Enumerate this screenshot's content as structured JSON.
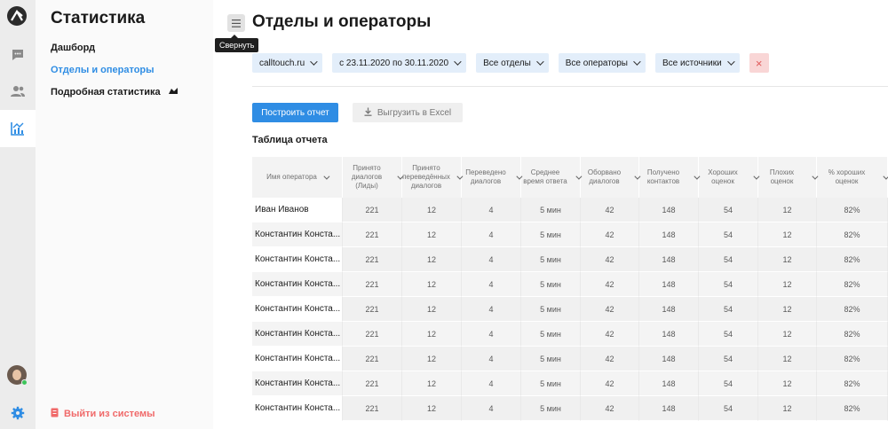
{
  "sidebar": {
    "title": "Статистика",
    "items": [
      {
        "label": "Дашборд"
      },
      {
        "label": "Отделы и операторы"
      },
      {
        "label": "Подробная статистика"
      }
    ],
    "logout_label": "Выйти из системы"
  },
  "header": {
    "title": "Отделы и операторы",
    "collapse_tooltip": "Свернуть"
  },
  "filters": [
    {
      "label": "calltouch.ru"
    },
    {
      "label": "с 23.11.2020 по 30.11.2020"
    },
    {
      "label": "Все отделы"
    },
    {
      "label": "Все операторы"
    },
    {
      "label": "Все источники"
    }
  ],
  "clear_label": "×",
  "actions": {
    "build_label": "Построить отчет",
    "export_label": "Выгрузить в Excel"
  },
  "table": {
    "title": "Таблица отчета",
    "columns": [
      "Имя оператора",
      "Принято диалогов (Лиды)",
      "Принято переведённых диалогов",
      "Переведено диалогов",
      "Среднее время ответа",
      "Оборвано диалогов",
      "Получено контактов",
      "Хороших оценок",
      "Плохих оценок",
      "% хороших оценок"
    ],
    "rows": [
      [
        "Иван Иванов",
        "221",
        "12",
        "4",
        "5 мин",
        "42",
        "148",
        "54",
        "12",
        "82%"
      ],
      [
        "Константин Конста...",
        "221",
        "12",
        "4",
        "5 мин",
        "42",
        "148",
        "54",
        "12",
        "82%"
      ],
      [
        "Константин Конста...",
        "221",
        "12",
        "4",
        "5 мин",
        "42",
        "148",
        "54",
        "12",
        "82%"
      ],
      [
        "Константин Конста...",
        "221",
        "12",
        "4",
        "5 мин",
        "42",
        "148",
        "54",
        "12",
        "82%"
      ],
      [
        "Константин Конста...",
        "221",
        "12",
        "4",
        "5 мин",
        "42",
        "148",
        "54",
        "12",
        "82%"
      ],
      [
        "Константин Конста...",
        "221",
        "12",
        "4",
        "5 мин",
        "42",
        "148",
        "54",
        "12",
        "82%"
      ],
      [
        "Константин Конста...",
        "221",
        "12",
        "4",
        "5 мин",
        "42",
        "148",
        "54",
        "12",
        "82%"
      ],
      [
        "Константин Конста...",
        "221",
        "12",
        "4",
        "5 мин",
        "42",
        "148",
        "54",
        "12",
        "82%"
      ],
      [
        "Константин Конста...",
        "221",
        "12",
        "4",
        "5 мин",
        "42",
        "148",
        "54",
        "12",
        "82%"
      ]
    ]
  },
  "colors": {
    "accent": "#2f8de4",
    "danger": "#f06a6a",
    "filter_bg": "#e3eefa"
  },
  "icons": {
    "rail": [
      "logo-icon",
      "chat-icon",
      "users-icon",
      "chart-icon",
      "gear-icon"
    ],
    "nav_beta": "new-badge-icon"
  }
}
